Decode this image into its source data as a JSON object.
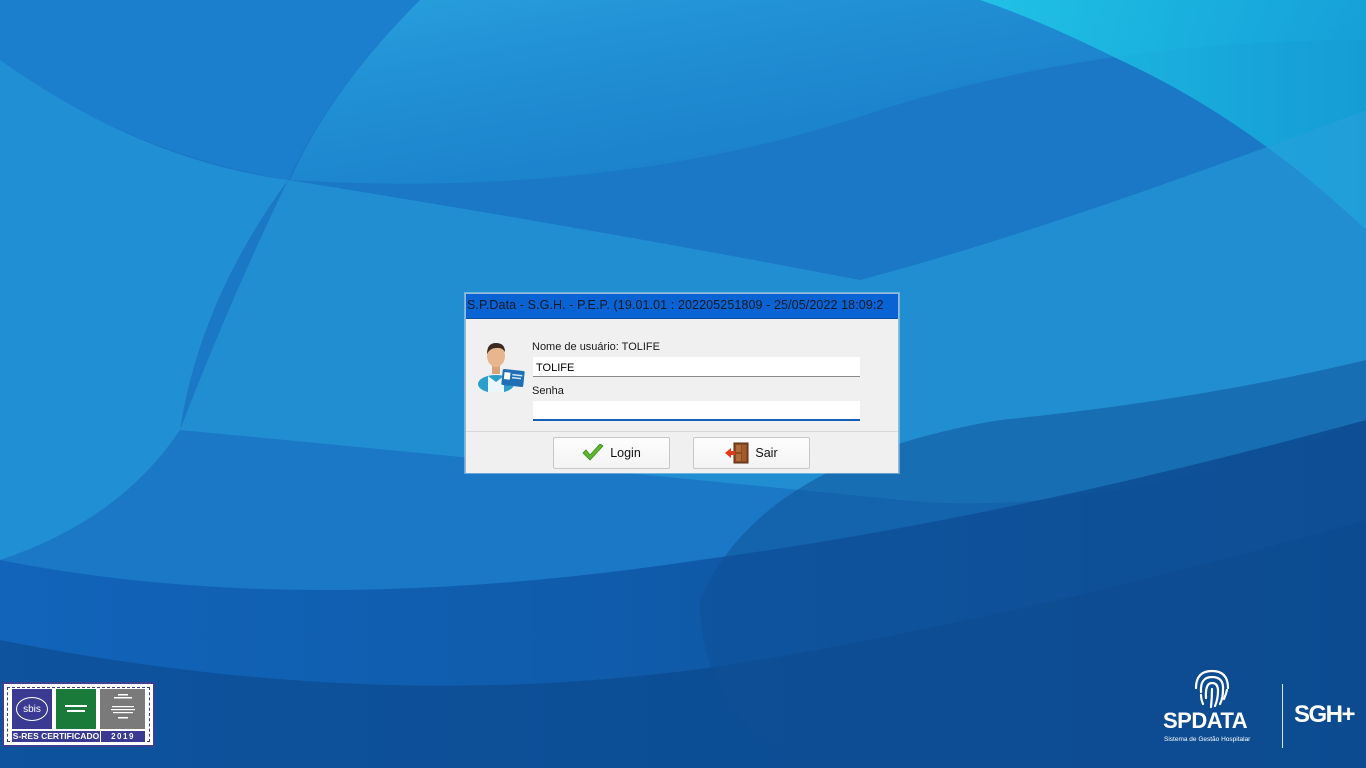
{
  "colors": {
    "titlebar": "#0a63d2",
    "dialog_bg": "#f0f0f0",
    "focus_accent": "#1560b5",
    "badge_blue": "#3a3a92",
    "badge_green": "#1a7a3a"
  },
  "dialog": {
    "title": "S.P.Data - S.G.H. - P.E.P. (19.01.01 : 202205251809 - 25/05/2022  18:09:2",
    "user_icon": "user-id-card-icon",
    "username_label": "Nome de usuário: TOLIFE",
    "username_value": "TOLIFE",
    "password_label": "Senha",
    "password_value": "",
    "login_button": {
      "label": "Login",
      "icon": "checkmark-icon"
    },
    "exit_button": {
      "label": "Sair",
      "icon": "exit-door-icon"
    }
  },
  "badge": {
    "sbis": "sbis",
    "label": "S-RES CERTIFICADO",
    "year": "2019"
  },
  "branding": {
    "logo_icon": "fingerprint-icon",
    "name": "SPDATA",
    "subtitle": "Sistema de Gestão Hospitalar",
    "product": "SGH+"
  }
}
